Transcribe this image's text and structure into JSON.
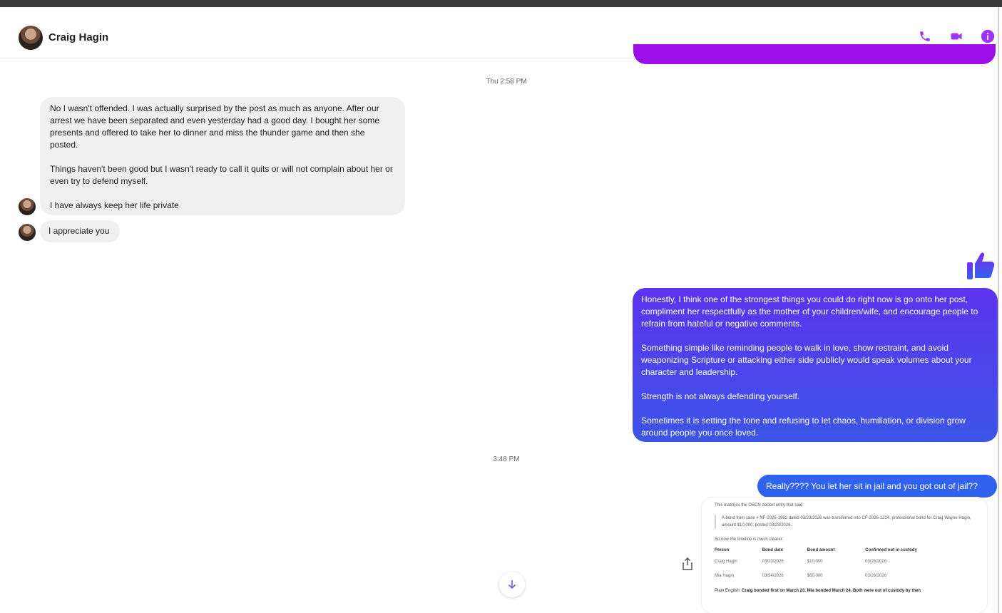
{
  "header": {
    "contact_name": "Craig Hagin",
    "icons": [
      "phone-icon",
      "video-icon",
      "info-icon"
    ],
    "accent_color": "#a033ff"
  },
  "messages": {
    "timestamp_1": "Thu 2:58 PM",
    "incoming_1_para_1": "No I wasn't offended. I was actually surprised by the post as much as anyone.  After our arrest we have been separated and even yesterday had a good day. I bought her some presents and offered to take her to dinner and miss the thunder game and then she posted.",
    "incoming_1_para_2": "Things haven't been good but I wasn't ready to call it quits or will not complain about her or even try to defend myself.",
    "incoming_1_para_3": "I have always keep her life private",
    "incoming_2": "I appreciate you",
    "outgoing_1_para_1": "Honestly, I think one of the strongest things you could do right now is go onto her post, compliment her respectfully as the mother of your children/wife, and encourage people to refrain from hateful or negative comments.",
    "outgoing_1_para_2": "Something simple like reminding people to walk in love, show restraint, and avoid weaponizing Scripture or attacking either side publicly would speak volumes about your character and leadership.",
    "outgoing_1_para_3": "Strength is not always defending yourself.",
    "outgoing_1_para_4": "Sometimes it is setting the tone and refusing to let chaos, humiliation, or division grow around people you once loved.",
    "timestamp_2": "3:48 PM",
    "outgoing_2": "Really???? You let her sit in jail and you got out of jail??"
  },
  "doc_card": {
    "intro": "This matches the OSCN docket entry that said:",
    "quote": "A bond from case # NF-2026-1962 dated 03/23/2026 was transferred into CF-2026-1224, professional bond for Craig Wayne Hagin, amount $10,000, posted 03/23/2026.",
    "note": "So now the timeline is much clearer:",
    "columns": [
      "Person",
      "Bond date",
      "Bond amount",
      "Confirmed not in custody"
    ],
    "rows": [
      [
        "Craig Hagin",
        "03/23/2026",
        "$10,000",
        "03/26/2026"
      ],
      [
        "Mia Hagin",
        "03/24/2026",
        "$60,000",
        "03/26/2026"
      ]
    ],
    "plain_label": "Plain English:",
    "plain_text": "Craig bonded first on March 23. Mia bonded March 24. Both were out of custody by then"
  }
}
